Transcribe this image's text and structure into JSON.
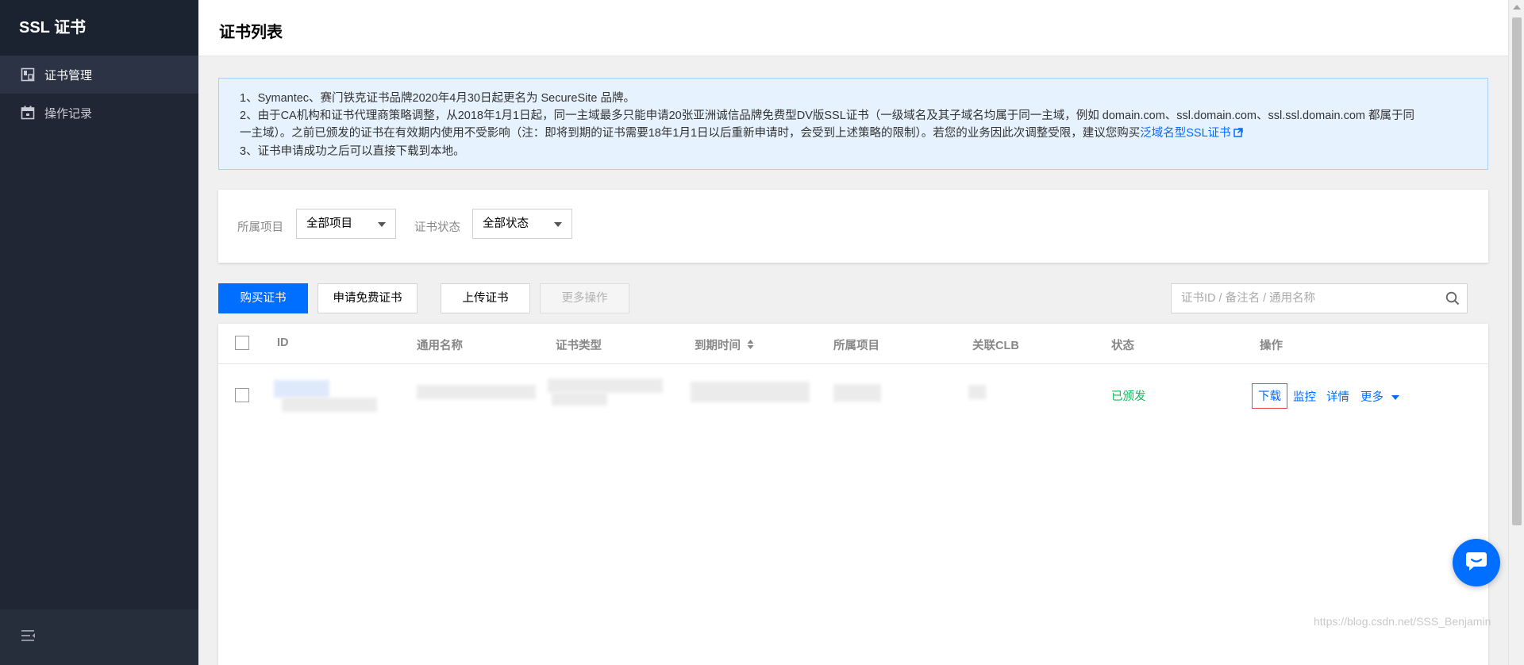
{
  "sidebar": {
    "title": "SSL 证书",
    "items": [
      {
        "label": "证书管理",
        "icon": "certificate-icon",
        "active": true
      },
      {
        "label": "操作记录",
        "icon": "calendar-icon",
        "active": false
      }
    ],
    "collapse_icon": "collapse-menu-icon"
  },
  "header": {
    "title": "证书列表"
  },
  "notice": {
    "line1": "1、Symantec、赛门铁克证书品牌2020年4月30日起更名为 SecureSite 品牌。",
    "line2a": "2、由于CA机构和证书代理商策略调整，从2018年1月1日起，同一主域最多只能申请20张亚洲诚信品牌免费型DV版SSL证书（一级域名及其子域名均属于同一主域，例如 domain.com、ssl.domain.com、ssl.ssl.domain.com 都属于同",
    "line2b": "一主域）。之前已颁发的证书在有效期内使用不受影响（注：即将到期的证书需要18年1月1日以后重新申请时，会受到上述策略的限制）。若您的业务因此次调整受限，建议您购买",
    "link": "泛域名型SSL证书",
    "line3": "3、证书申请成功之后可以直接下载到本地。"
  },
  "filters": {
    "project_label": "所属项目",
    "project_value": "全部项目",
    "status_label": "证书状态",
    "status_value": "全部状态"
  },
  "toolbar": {
    "buy": "购买证书",
    "free": "申请免费证书",
    "upload": "上传证书",
    "more_ops": "更多操作",
    "search_placeholder": "证书ID / 备注名 / 通用名称"
  },
  "table": {
    "columns": [
      "ID",
      "通用名称",
      "证书类型",
      "到期时间",
      "所属项目",
      "关联CLB",
      "状态",
      "操作"
    ],
    "rows": [
      {
        "status": "已颁发",
        "actions": {
          "download": "下载",
          "monitor": "监控",
          "details": "详情",
          "more": "更多"
        }
      }
    ]
  },
  "watermark": "https://blog.csdn.net/SSS_Benjamin",
  "colors": {
    "primary": "#006eff",
    "success": "#0abf5b",
    "sidebar": "#202633",
    "highlight_box": "#e54545"
  }
}
